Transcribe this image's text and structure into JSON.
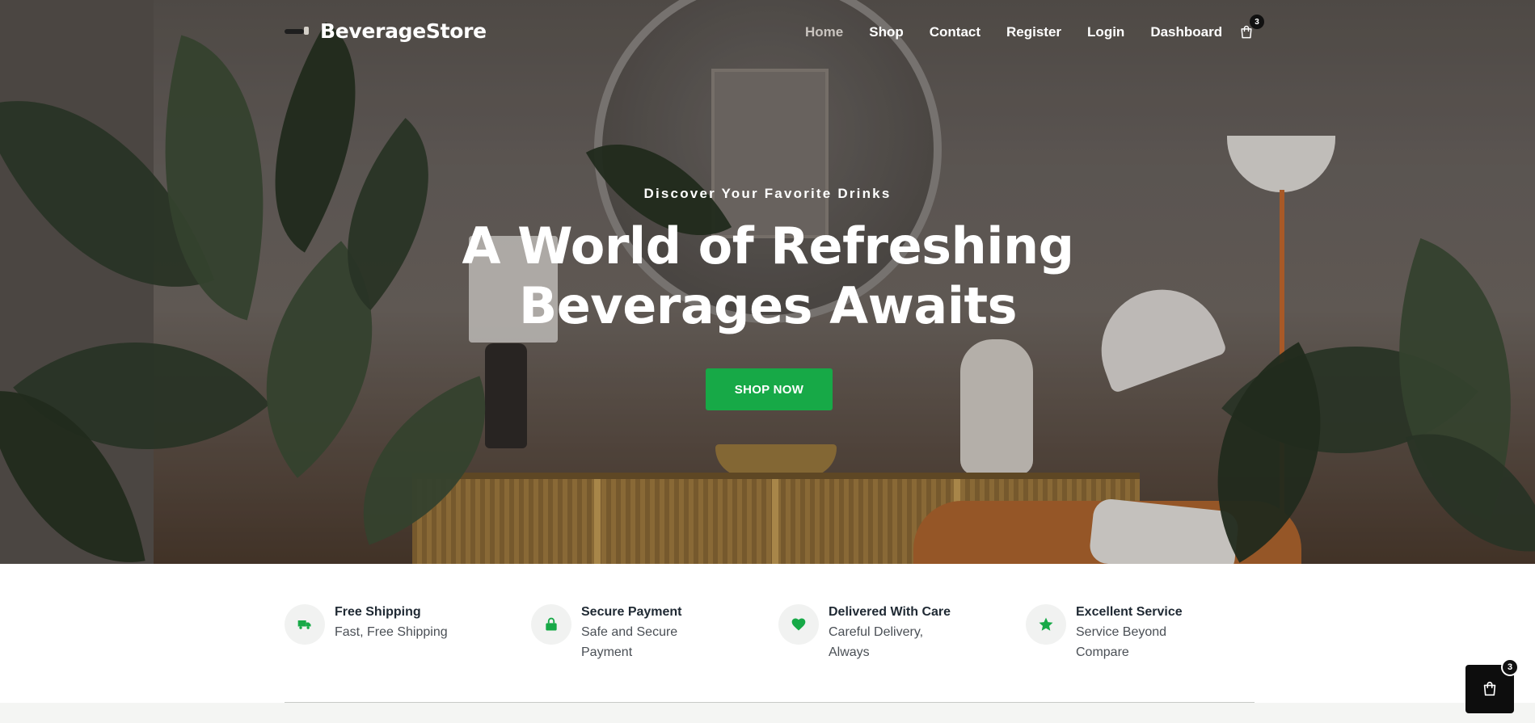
{
  "nav": {
    "brand": "BeverageStore",
    "items": [
      {
        "label": "Home",
        "active": true
      },
      {
        "label": "Shop",
        "active": false
      },
      {
        "label": "Contact",
        "active": false
      },
      {
        "label": "Register",
        "active": false
      },
      {
        "label": "Login",
        "active": false
      },
      {
        "label": "Dashboard",
        "active": false
      }
    ],
    "cart_icon": "shopping-bag-icon",
    "cart_count": "3"
  },
  "hero": {
    "eyebrow": "Discover Your Favorite Drinks",
    "headline_line1": "A World of Refreshing",
    "headline_line2": "Beverages Awaits",
    "cta": "SHOP NOW",
    "cta_color": "#17a947"
  },
  "features": [
    {
      "icon": "truck-icon",
      "title": "Free Shipping",
      "subtitle": "Fast, Free Shipping"
    },
    {
      "icon": "lock-icon",
      "title": "Secure Payment",
      "subtitle": "Safe and Secure Payment"
    },
    {
      "icon": "heart-icon",
      "title": "Delivered With Care",
      "subtitle": "Careful Delivery, Always"
    },
    {
      "icon": "star-icon",
      "title": "Excellent Service",
      "subtitle": "Service Beyond Compare"
    }
  ],
  "floating_cart": {
    "icon": "shopping-bag-icon",
    "count": "3"
  },
  "colors": {
    "accent": "#17a947",
    "dark": "#0d0d0d"
  }
}
